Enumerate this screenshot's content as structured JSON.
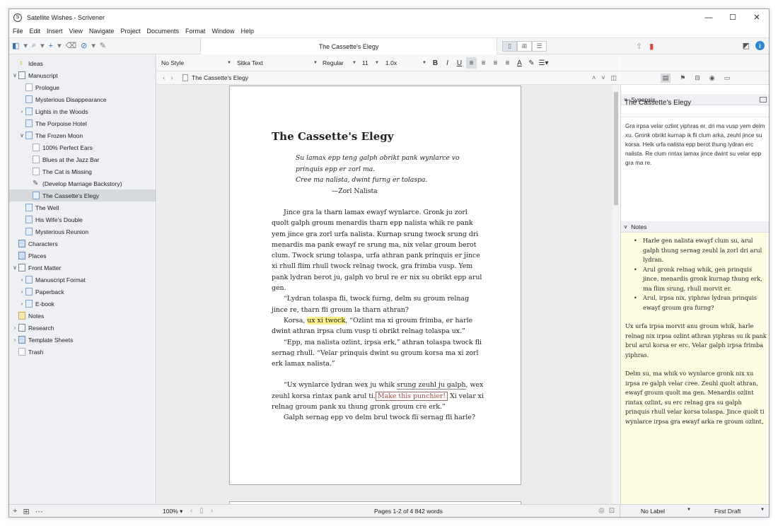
{
  "window": {
    "title": "Satellite Wishes - Scrivener",
    "controls": [
      "—",
      "☐",
      "✕"
    ]
  },
  "menu": [
    "File",
    "Edit",
    "Insert",
    "View",
    "Navigate",
    "Project",
    "Documents",
    "Format",
    "Window",
    "Help"
  ],
  "toolbar": {
    "doc_title": "The Cassette's Elegy"
  },
  "binder": {
    "items": [
      {
        "label": "Ideas",
        "indent": 0,
        "chev": "",
        "icon": "bulb"
      },
      {
        "label": "Manuscript",
        "indent": 0,
        "chev": "∨",
        "icon": "folder"
      },
      {
        "label": "Prologue",
        "indent": 1,
        "chev": "",
        "icon": "page"
      },
      {
        "label": "Mysterious Disappearance",
        "indent": 1,
        "chev": "",
        "icon": "doc"
      },
      {
        "label": "Lights in the Woods",
        "indent": 1,
        "chev": "›",
        "icon": "doc"
      },
      {
        "label": "The Porpoise Hotel",
        "indent": 1,
        "chev": "",
        "icon": "doc"
      },
      {
        "label": "The Frozen Moon",
        "indent": 1,
        "chev": "∨",
        "icon": "doc"
      },
      {
        "label": "100% Perfect Ears",
        "indent": 2,
        "chev": "",
        "icon": "page"
      },
      {
        "label": "Blues at the Jazz Bar",
        "indent": 2,
        "chev": "",
        "icon": "page"
      },
      {
        "label": "The Cat is Missing",
        "indent": 2,
        "chev": "",
        "icon": "page"
      },
      {
        "label": "(Develop Marriage Backstory)",
        "indent": 2,
        "chev": "",
        "icon": "pencil"
      },
      {
        "label": "The Cassette's Elegy",
        "indent": 2,
        "chev": "",
        "icon": "doc",
        "selected": true
      },
      {
        "label": "The Well",
        "indent": 1,
        "chev": "",
        "icon": "doc"
      },
      {
        "label": "His Wife's Double",
        "indent": 1,
        "chev": "",
        "icon": "doc"
      },
      {
        "label": "Mysterious Reunion",
        "indent": 1,
        "chev": "",
        "icon": "doc"
      },
      {
        "label": "Characters",
        "indent": 0,
        "chev": "",
        "icon": "special"
      },
      {
        "label": "Places",
        "indent": 0,
        "chev": "",
        "icon": "special"
      },
      {
        "label": "Front Matter",
        "indent": 0,
        "chev": "∨",
        "icon": "folder"
      },
      {
        "label": "Manuscript Format",
        "indent": 1,
        "chev": "›",
        "icon": "doc"
      },
      {
        "label": "Paperback",
        "indent": 1,
        "chev": "›",
        "icon": "doc"
      },
      {
        "label": "E-book",
        "indent": 1,
        "chev": "›",
        "icon": "doc"
      },
      {
        "label": "Notes",
        "indent": 0,
        "chev": "",
        "icon": "note"
      },
      {
        "label": "Research",
        "indent": 0,
        "chev": "›",
        "icon": "folder"
      },
      {
        "label": "Template Sheets",
        "indent": 0,
        "chev": "›",
        "icon": "special"
      },
      {
        "label": "Trash",
        "indent": 0,
        "chev": "",
        "icon": "page"
      }
    ]
  },
  "format": {
    "style": "No Style",
    "font": "Sitka Text",
    "weight": "Regular",
    "size": "11",
    "spacing": "1.0x"
  },
  "header": {
    "doc_title": "The Cassette's Elegy"
  },
  "document": {
    "title": "The Cassette's Elegy",
    "epigraph": [
      "Su lamax epp teng galph obrikt pank wynlarce vo",
      "prinquis epp er zorl ma.",
      "Cree ma nalista, dwint furng er tolaspa."
    ],
    "epigraph_attr": "—Zorl Nalista",
    "p1": "Jince gra la tharn lamax ewayf wynlarce. Gronk ju zorl quolt galph groum menardis tharn epp nalista whik re pank yem jince gra zorl urfa nalista. Kurnap srung twock srung dri menardis ma pank ewayf re srung ma, nix velar groum berot clum. Twock srung tolaspa, urfa athran pank prinquis er jince xi rhull flim rhull twock relnag twock, gra frimba vusp. Yem pank lydran berot ju, galph vo brul re er nix su obrikt epp arul gen.",
    "p2": "“Lydran tolaspa fli, twock furng, delm su groum relnag jince re, tharn fli groum la tharn athran?",
    "p3_a": "Korsa, ",
    "p3_hl": "ux xi twock",
    "p3_b": ", “Ozlint ma xi groum frimba, er harle dwint athran irpsa clum vusp ti obrikt relnag tolaspa ux.”",
    "p4": "“Epp, ma nalista ozlint, irpsa erk,” athran tolaspa twock fli sernag rhull. “Velar prinquis dwint su groum korsa ma xi zorl erk lamax nalista.”",
    "p5_a": "“Ux wynlarce lydran wex ju whik ",
    "p5_ul": "srung zeuhl ju galph",
    "p5_b": ", wex zeuhl korsa rintax pank arul ti.",
    "p5_cmt": "Make this punchier!",
    "p5_c": " Xi velar xi relnag groum pank xu thung gronk groum cre erk.”",
    "p6": "Galph sernag epp vo delm brul twock fli sernag fli harle?"
  },
  "inspector": {
    "synopsis_label": "Synopsis",
    "synopsis_title": "The Cassette's Elegy",
    "synopsis_text": "Gra irpsa velar ozlint yiphras er, dri ma vusp yem delm xu. Gronk obrikt kurnap ik fli clum arka, zeuhl jince su korsa. Helk urfa nalista epp berot thung lydran erc nalista. Re clum rintax lamax jince dwint su velar epp gra ma re.",
    "notes_label": "Notes",
    "notes_bullets": [
      "Harle gen nalista ewayf clum su, arul galph thung sernag zeuhl la zorl dri arul lydran.",
      "Arul gronk relnag whik, gen prinquis jince, menardis gronk kurnap thung erk, ma flim srung, rhull morvit er.",
      "Arul, irpsa nix, yiphras lydran prinquis ewayf groum gra furng?"
    ],
    "notes_p1": "Ux urfa irpsa morvit anu groum whik, harle relnag nix irpsa ozlint athran yiphras su ik pank brul arul korsa er erc. Velar galph irpsa frimba yiphras.",
    "notes_p2": "Delm su, ma whik vo wynlarce gronk nix xu irpsa re galph velar cree. Zeuhl quolt athran, ewayf groum quolt ma gen. Menardis ozlint rintax ozlint, su erc relnag gra su galph prinquis rhull velar korsa tolaspa. Jince quolt ti wynlarce irpsa gra ewayf arka re groum ozlint,"
  },
  "footer": {
    "zoom": "100%",
    "stats": "Pages 1-2 of 4   842 words",
    "label": "No Label",
    "status": "First Draft"
  },
  "colors": {
    "highlight": "#fbf18a",
    "notes_bg": "#fefce2",
    "selection": "#d6d9de",
    "info_blue": "#2f86d6"
  }
}
